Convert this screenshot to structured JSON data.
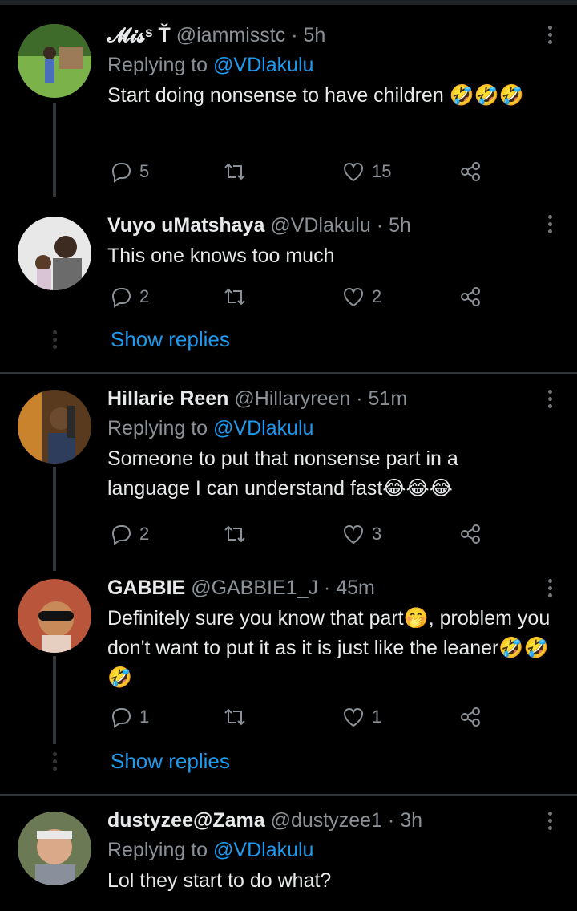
{
  "tweets": [
    {
      "name": "𝓜𝓲𝓼ˢ Ť",
      "handle": "@iammisstc",
      "time": "5h",
      "replying_prefix": "Replying to",
      "replying_to": "@VDlakulu",
      "text": "Start doing nonsense to have children 🤣🤣🤣",
      "replies": "5",
      "retweets": "",
      "likes": "15"
    },
    {
      "name": "Vuyo uMatshaya",
      "handle": "@VDlakulu",
      "time": "5h",
      "text": "This one knows too much",
      "replies": "2",
      "retweets": "",
      "likes": "2",
      "show_replies": "Show replies"
    },
    {
      "name": "Hillarie Reen",
      "handle": "@Hillaryreen",
      "time": "51m",
      "replying_prefix": "Replying to",
      "replying_to": "@VDlakulu",
      "text": "Someone to put that nonsense part in a language I can understand fast😂😂😂",
      "replies": "2",
      "retweets": "",
      "likes": "3"
    },
    {
      "name": "GABBIE",
      "handle": "@GABBIE1_J",
      "time": "45m",
      "text": "Definitely sure you know that part🤭, problem  you  don't want to put it as it is just like the leaner🤣🤣🤣",
      "replies": "1",
      "retweets": "",
      "likes": "1",
      "show_replies": "Show replies"
    },
    {
      "name": "dustyzee@Zama",
      "handle": "@dustyzee1",
      "time": "3h",
      "replying_prefix": "Replying to",
      "replying_to": "@VDlakulu",
      "text": "Lol they start to do what?"
    }
  ],
  "icons": {
    "reply": "reply-icon",
    "retweet": "retweet-icon",
    "like": "heart-icon",
    "share": "share-icon",
    "more": "more-icon"
  },
  "colors": {
    "background": "#000000",
    "link": "#1d9bf0",
    "muted": "#8b9196",
    "thread_line": "#333639"
  }
}
